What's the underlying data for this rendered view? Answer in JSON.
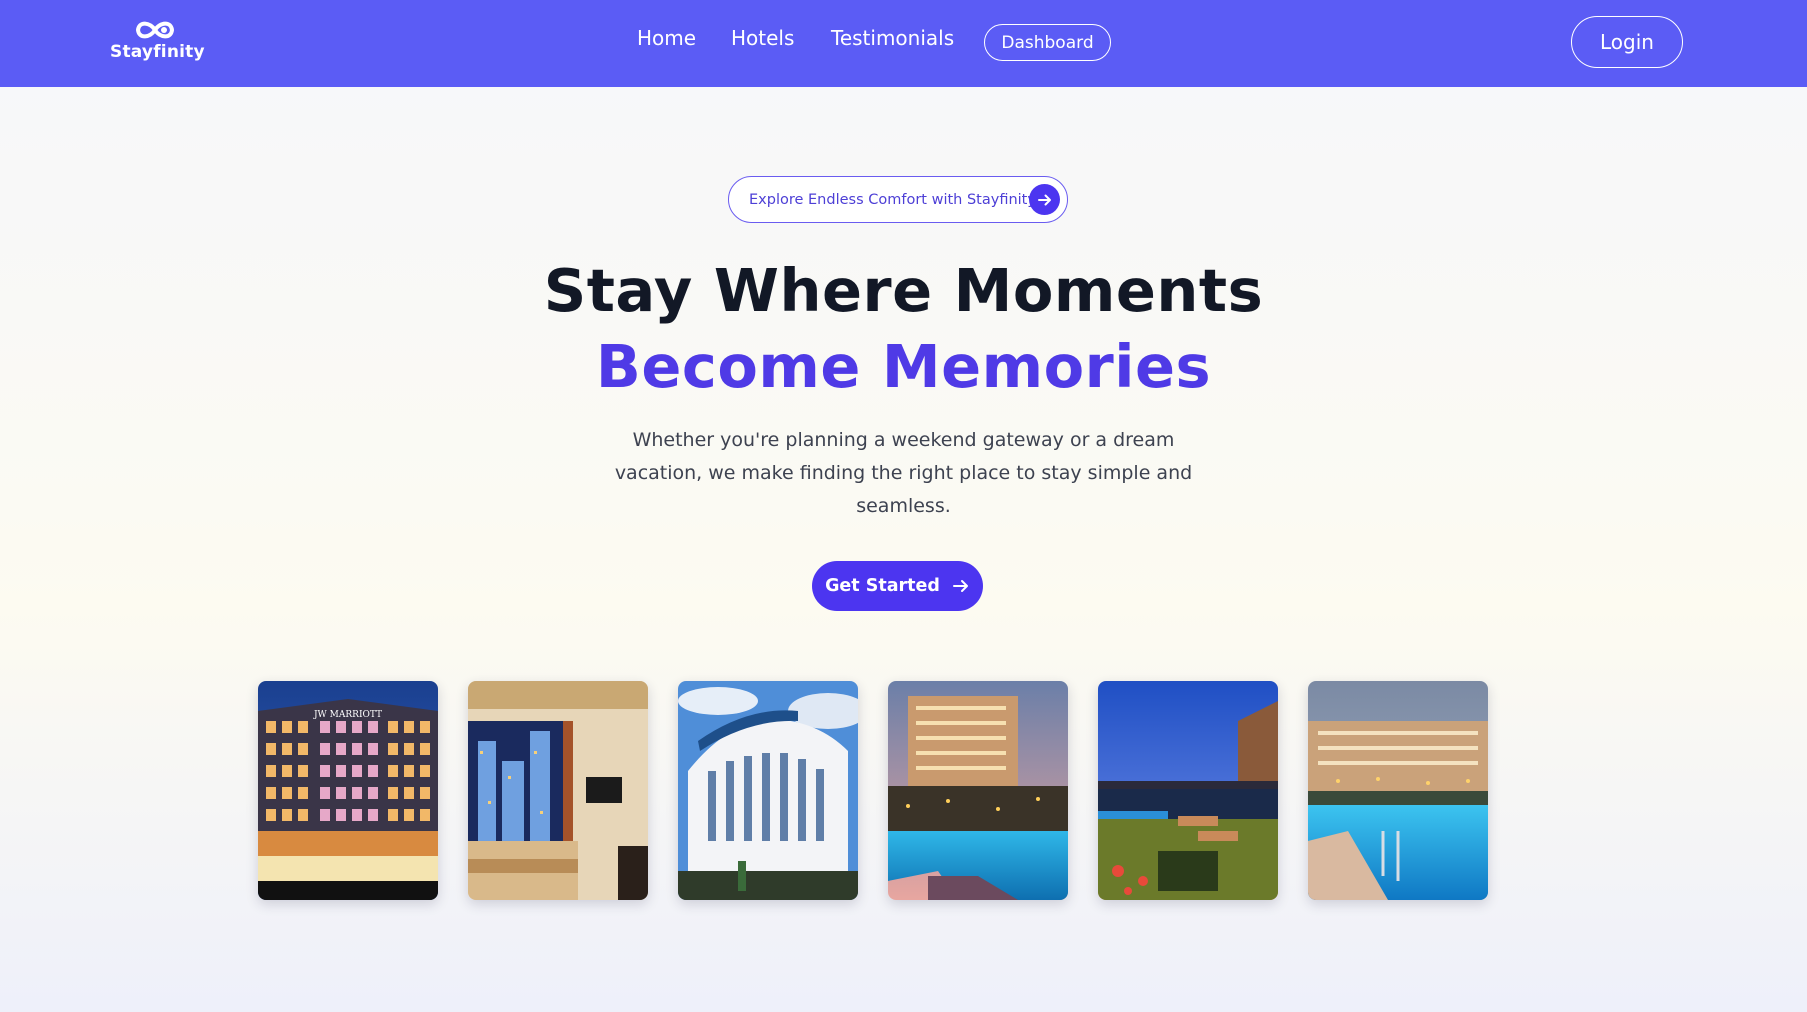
{
  "brand": {
    "name": "Stayfinity",
    "logo_icon": "infinity-icon",
    "accent": "#5b5cf5",
    "primary": "#4c35f0"
  },
  "nav": {
    "links": [
      "Home",
      "Hotels",
      "Testimonials"
    ],
    "dashboard_label": "Dashboard",
    "login_label": "Login"
  },
  "hero": {
    "pill_text": "Explore Endless Comfort with Stayfinity",
    "pill_icon": "arrow-right-icon",
    "title_line1": "Stay Where Moments",
    "title_line2": "Become Memories",
    "description": "Whether you're planning a weekend gateway or a dream vacation, we make finding the right place to stay simple and seamless.",
    "cta_label": "Get Started",
    "cta_icon": "arrow-right-icon"
  },
  "gallery": {
    "items": [
      {
        "kind": "hotel-facade-night",
        "sign": "JW MARRIOTT"
      },
      {
        "kind": "hotel-room-view"
      },
      {
        "kind": "hotel-white-building"
      },
      {
        "kind": "resort-pool-sunset"
      },
      {
        "kind": "terrace-dusk"
      },
      {
        "kind": "resort-pool-evening"
      }
    ]
  }
}
